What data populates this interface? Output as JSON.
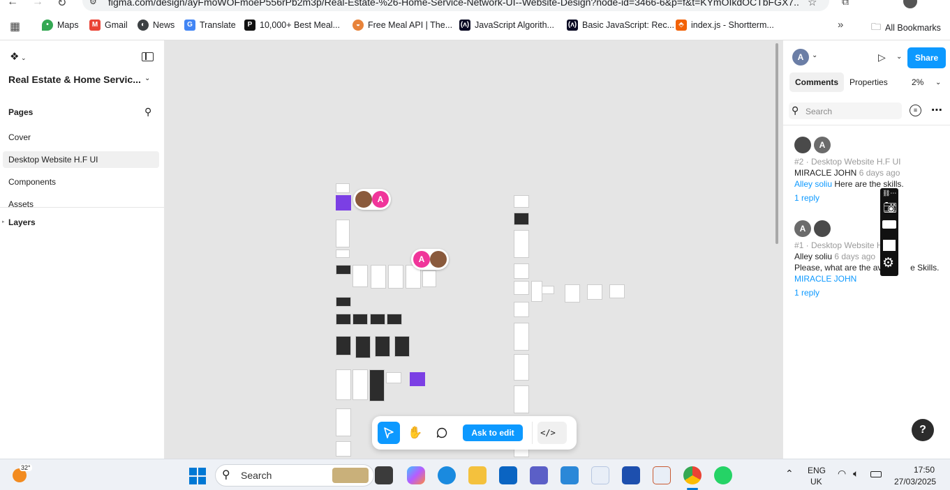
{
  "browser": {
    "url": "figma.com/design/ayFmoWOFmoeP556rPb2m3p/Real-Estate-%26-Home-Service-Network-UI--Website-Design?node-id=3466-6&p=f&t=KYmOIkdOCTbFGX7...",
    "bookmarks": [
      {
        "label": "Maps",
        "icon": "maps-pin-icon"
      },
      {
        "label": "Gmail",
        "icon": "gmail-icon"
      },
      {
        "label": "News",
        "icon": "news-icon"
      },
      {
        "label": "Translate",
        "icon": "translate-icon"
      },
      {
        "label": "10,000+ Best Meal...",
        "icon": "meal-icon"
      },
      {
        "label": "Free Meal API | The...",
        "icon": "mealdb-icon"
      },
      {
        "label": "JavaScript Algorith...",
        "icon": "freecodecamp-icon"
      },
      {
        "label": "Basic JavaScript: Rec...",
        "icon": "freecodecamp-icon"
      },
      {
        "label": "index.js - Shortterm...",
        "icon": "replit-icon"
      }
    ],
    "all_bookmarks": "All Bookmarks"
  },
  "left": {
    "file_title": "Real Estate & Home Servic...",
    "pages_heading": "Pages",
    "pages": [
      "Cover",
      "Desktop Website H.F UI",
      "Components",
      "Assets"
    ],
    "selected_page": "Desktop Website H.F UI",
    "layers_heading": "Layers"
  },
  "canvas": {
    "avatar_letter": "A",
    "toolbar": {
      "ask_to_edit": "Ask to edit"
    }
  },
  "right": {
    "user_initial": "A",
    "share": "Share",
    "tabs": [
      "Comments",
      "Properties"
    ],
    "zoom": "2%",
    "search_placeholder": "Search",
    "comments": [
      {
        "avatars": [
          "photo",
          "A"
        ],
        "meta": "#2 · Desktop Website H.F UI",
        "author": "MIRACLE JOHN",
        "time": "6 days ago",
        "mention": "Alley soliu",
        "text": "Here are the skills.",
        "reply": "1 reply"
      },
      {
        "avatars": [
          "A",
          "photo"
        ],
        "meta": "#1 · Desktop Website H",
        "author": "Alley soliu",
        "time": "6 days ago",
        "text_before": "Please, what are the ava",
        "text_after": "e Skills.",
        "mention": "MIRACLE JOHN",
        "reply": "1 reply"
      }
    ],
    "help": "?"
  },
  "taskbar": {
    "weather": "32°",
    "search": "Search",
    "lang_top": "ENG",
    "lang_bottom": "UK",
    "time": "17:50",
    "date": "27/03/2025"
  }
}
